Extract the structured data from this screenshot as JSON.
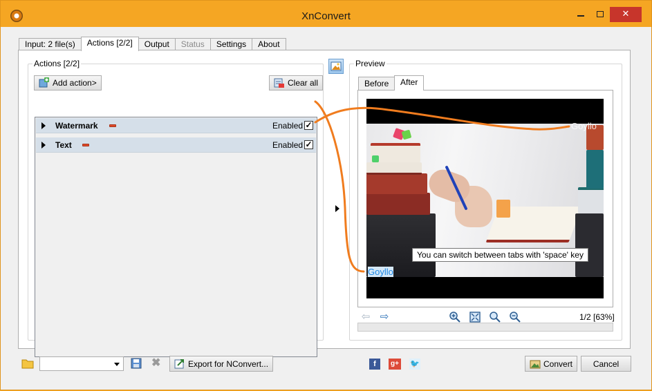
{
  "window": {
    "title": "XnConvert"
  },
  "tabs": [
    {
      "label": "Input: 2 file(s)"
    },
    {
      "label": "Actions [2/2]"
    },
    {
      "label": "Output"
    },
    {
      "label": "Status"
    },
    {
      "label": "Settings"
    },
    {
      "label": "About"
    }
  ],
  "actions": {
    "group_label": "Actions [2/2]",
    "add_action_label": "Add action>",
    "clear_all_label": "Clear all",
    "items": [
      {
        "name": "Watermark",
        "enabled_label": "Enabled",
        "enabled": true
      },
      {
        "name": "Text",
        "enabled_label": "Enabled",
        "enabled": true
      }
    ]
  },
  "preview": {
    "group_label": "Preview",
    "tabs": [
      {
        "label": "Before"
      },
      {
        "label": "After"
      }
    ],
    "watermark_text": "Goyllo",
    "tooltip": "You can switch between tabs with 'space' key",
    "page_info": "1/2 [63%]"
  },
  "bottom": {
    "preset_value": "",
    "export_label": "Export for NConvert...",
    "convert_label": "Convert",
    "cancel_label": "Cancel"
  },
  "colors": {
    "titlebar": "#f5a623",
    "close": "#c7352b",
    "annotation": "#f07c1e",
    "watermark": "#1e88e5"
  }
}
